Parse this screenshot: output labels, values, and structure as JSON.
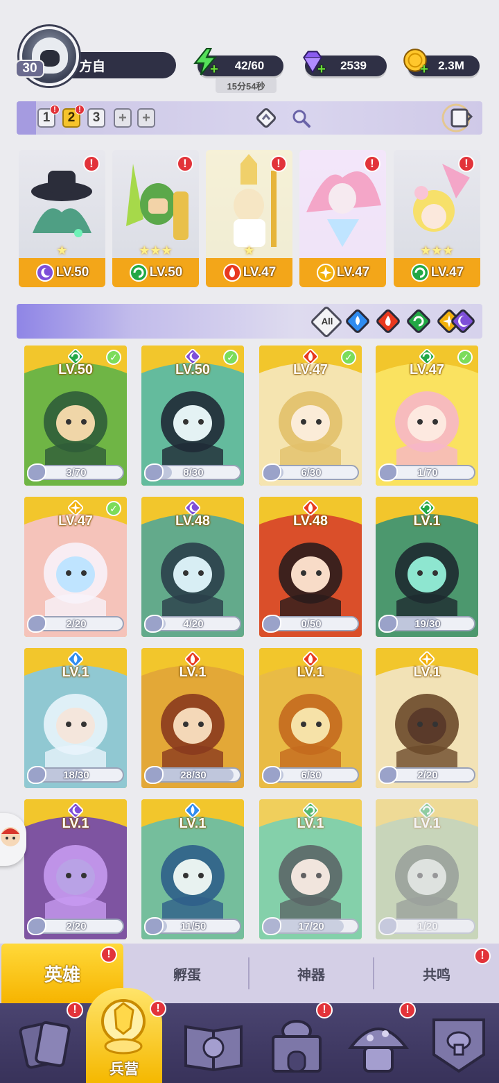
{
  "player": {
    "level": "30",
    "name": "方自"
  },
  "resources": {
    "energy": "42/60",
    "energy_timer": "15分54秒",
    "gems": "2539",
    "gold": "2.3M"
  },
  "team_tabs": [
    {
      "label": "1",
      "active": false,
      "alert": true
    },
    {
      "label": "2",
      "active": true,
      "alert": true
    },
    {
      "label": "3",
      "active": false,
      "alert": false
    },
    {
      "label": "+",
      "active": false,
      "alert": false
    },
    {
      "label": "+",
      "active": false,
      "alert": false
    }
  ],
  "team_slots": [
    {
      "level": "LV.50",
      "element": "dark",
      "stars": "★",
      "alert": "!"
    },
    {
      "level": "LV.50",
      "element": "wind",
      "stars": "★★★",
      "alert": "!"
    },
    {
      "level": "LV.47",
      "element": "fire",
      "stars": "★",
      "alert": "!"
    },
    {
      "level": "LV.47",
      "element": "light",
      "stars": "",
      "alert": "!"
    },
    {
      "level": "LV.47",
      "element": "wind",
      "stars": "★★★",
      "alert": "!"
    }
  ],
  "filters": {
    "all_label": "All",
    "elements": [
      "water",
      "fire",
      "wind",
      "light",
      "dark"
    ]
  },
  "heroes": [
    {
      "level": "LV.50",
      "element": "wind",
      "fragments": "3/70",
      "progress": 0.04,
      "check": true
    },
    {
      "level": "LV.50",
      "element": "dark",
      "fragments": "8/30",
      "progress": 0.27,
      "check": true
    },
    {
      "level": "LV.47",
      "element": "fire",
      "fragments": "6/30",
      "progress": 0.2,
      "check": true
    },
    {
      "level": "LV.47",
      "element": "wind",
      "fragments": "1/70",
      "progress": 0.01,
      "check": true
    },
    {
      "level": "LV.47",
      "element": "light",
      "fragments": "2/20",
      "progress": 0.1,
      "check": true
    },
    {
      "level": "LV.48",
      "element": "dark",
      "fragments": "4/20",
      "progress": 0.2,
      "check": false
    },
    {
      "level": "LV.48",
      "element": "fire",
      "fragments": "0/50",
      "progress": 0.0,
      "check": false
    },
    {
      "level": "LV.1",
      "element": "wind",
      "fragments": "19/30",
      "progress": 0.63,
      "check": false
    },
    {
      "level": "LV.1",
      "element": "water",
      "fragments": "18/30",
      "progress": 0.6,
      "check": false
    },
    {
      "level": "LV.1",
      "element": "fire",
      "fragments": "28/30",
      "progress": 0.93,
      "check": false
    },
    {
      "level": "LV.1",
      "element": "fire",
      "fragments": "6/30",
      "progress": 0.2,
      "check": false
    },
    {
      "level": "LV.1",
      "element": "light",
      "fragments": "2/20",
      "progress": 0.1,
      "check": false
    },
    {
      "level": "LV.1",
      "element": "dark",
      "fragments": "2/20",
      "progress": 0.1,
      "check": false
    },
    {
      "level": "LV.1",
      "element": "water",
      "fragments": "11/50",
      "progress": 0.22,
      "check": false
    },
    {
      "level": "LV.1",
      "element": "wind",
      "fragments": "17/20",
      "progress": 0.85,
      "check": false
    },
    {
      "level": "LV.1",
      "element": "wind",
      "fragments": "1/20",
      "progress": 0.05,
      "check": false
    }
  ],
  "sub_tabs": [
    {
      "label": "英雄",
      "active": true,
      "alert": "!"
    },
    {
      "label": "孵蛋",
      "active": false
    },
    {
      "label": "神器",
      "active": false
    },
    {
      "label": "共鸣",
      "active": false,
      "alert": "!"
    }
  ],
  "bottom_nav": {
    "active_label": "兵营",
    "items": [
      "cards",
      "barracks",
      "book",
      "castle",
      "mushroom-house",
      "guild-banner"
    ]
  },
  "colors": {
    "card_gold": "#f2c62c",
    "slot_orange": "#f3a619",
    "alert_red": "#e2333a",
    "water": "#2f8cf0",
    "fire": "#e8391f",
    "wind": "#22a845",
    "light": "#f2b10c",
    "dark": "#7e4fd8"
  }
}
